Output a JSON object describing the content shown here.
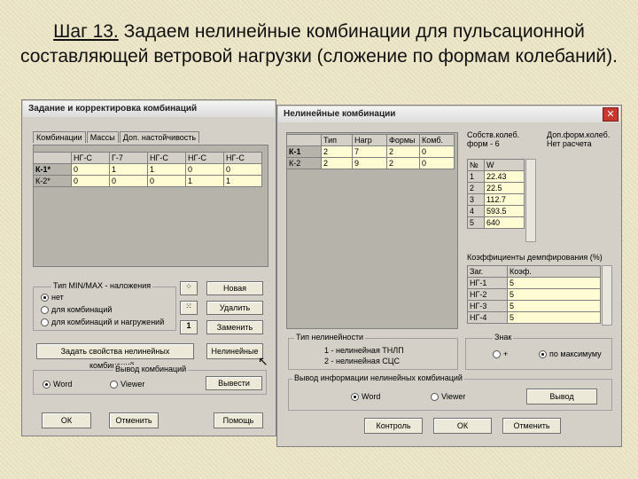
{
  "slide": {
    "title_step": "Шаг 13.",
    "title_rest": " Задаем нелинейные комбинации для пульсационной составляющей ветровой нагрузки (сложение по формам колебаний)."
  },
  "left_window": {
    "title": "Задание и корректировка комбинаций",
    "tabs": [
      "Комбинации",
      "Массы",
      "Доп. настойчивость"
    ],
    "columns": [
      "",
      "НГ-С",
      "Г-7",
      "НГ-С",
      "НГ-С",
      "НГ-С"
    ],
    "rows": [
      [
        "К-1*",
        "0",
        "1",
        "1",
        "0",
        "0"
      ],
      [
        "К-2*",
        "0",
        "0",
        "0",
        "1",
        "1"
      ]
    ],
    "group_title": "Тип MIN/MAX - наложения",
    "radios": [
      "нет",
      "для комбинаций",
      "для комбинаций и нагружений"
    ],
    "btn_new": "Новая",
    "btn_delete": "Удалить",
    "btn_replace": "Заменить",
    "btn_set_props": "Задать свойства нелинейных комбинаций...",
    "btn_nonlinear": "Нелинейные",
    "output_title": "Вывод комбинаций",
    "out_word": "Word",
    "out_viewer": "Viewer",
    "btn_output": "Вывести",
    "btn_ok": "ОК",
    "btn_cancel": "Отменить",
    "btn_help": "Помощь"
  },
  "right_window": {
    "title": "Нелинейные комбинации",
    "columns": [
      "",
      "Тип",
      "Нагр",
      "Формы",
      "Комб."
    ],
    "rows": [
      [
        "К-1",
        "2",
        "7",
        "2",
        "0"
      ],
      [
        "К-2",
        "2",
        "9",
        "2",
        "0"
      ]
    ],
    "own_forms_label": "Собств.колеб. форм - 6",
    "add_forms_label": "Доп.форм.колеб. Нет расчета",
    "forms_cols": [
      "№",
      "W"
    ],
    "forms": [
      [
        "1",
        "22.43"
      ],
      [
        "2",
        "22.5"
      ],
      [
        "3",
        "112.7"
      ],
      [
        "4",
        "593.5"
      ],
      [
        "5",
        "640"
      ]
    ],
    "damping_label": "Коэффициенты демпфирования (%)",
    "damping_cols": [
      "Заг.",
      "Коэф."
    ],
    "damping": [
      [
        "НГ-1",
        "5"
      ],
      [
        "НГ-2",
        "5"
      ],
      [
        "НГ-3",
        "5"
      ],
      [
        "НГ-4",
        "5"
      ]
    ],
    "nonlin_type_title": "Тип нелинейности",
    "nonlin_type_lines": [
      "1 - нелинейная ТНЛП",
      "2 - нелинейная СЦС"
    ],
    "sign_title": "Знак",
    "sign_plus": "+",
    "sign_mod": "по максимуму",
    "output_title": "Вывод информации нелинейных комбинаций",
    "out_word": "Word",
    "out_viewer": "Viewer",
    "btn_output": "Вывод",
    "btn_control": "Контроль",
    "btn_ok": "ОК",
    "btn_cancel": "Отменить"
  }
}
